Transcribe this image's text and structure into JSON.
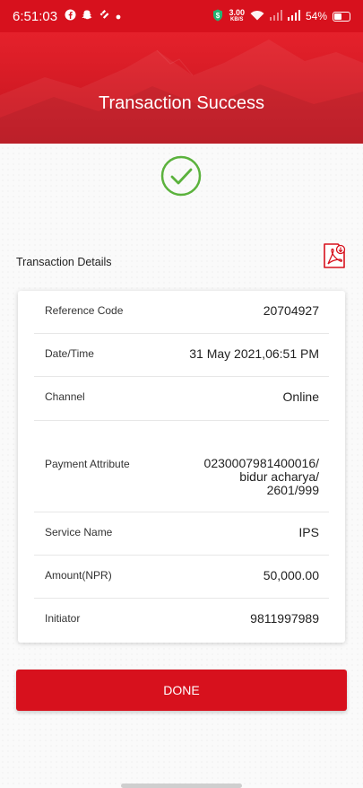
{
  "status_bar": {
    "time": "6:51:03",
    "net_speed_value": "3.00",
    "net_speed_unit": "KB/S",
    "battery": "54%",
    "icons": [
      "facebook-icon",
      "snapchat-icon",
      "binance-icon",
      "dot-icon",
      "wifi-icon",
      "signal-icon",
      "battery-icon"
    ]
  },
  "header": {
    "title": "Transaction Success"
  },
  "section": {
    "label": "Transaction Details"
  },
  "details": [
    {
      "label": "Reference Code",
      "value": "20704927"
    },
    {
      "label": "Date/Time",
      "value": "31 May 2021,06:51 PM"
    },
    {
      "label": "Channel",
      "value": "Online"
    },
    {
      "label": "Payment Attribute",
      "value_lines": [
        "0230007981400016/",
        "bidur acharya/",
        "2601/999"
      ]
    },
    {
      "label": "Service Name",
      "value": "IPS"
    },
    {
      "label": "Amount(NPR)",
      "value": "50,000.00"
    },
    {
      "label": "Initiator",
      "value": "9811997989"
    }
  ],
  "actions": {
    "done_label": "DONE"
  },
  "colors": {
    "brand_red": "#d7111d",
    "success_green": "#5bb23d"
  }
}
